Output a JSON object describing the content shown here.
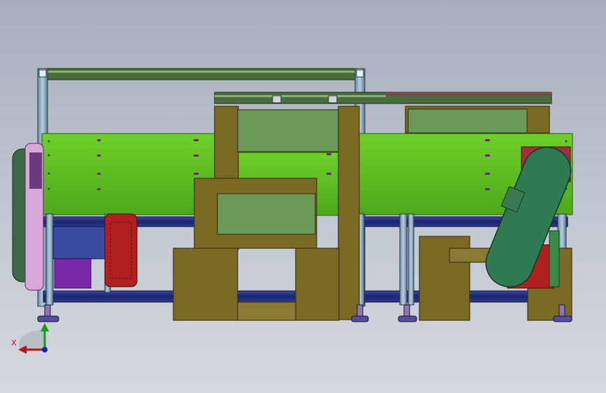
{
  "viewport": {
    "background_top": "#a6aebc",
    "background_bottom": "#d4d8de"
  },
  "colors": {
    "green_panel": "#5dba22",
    "green_panel_dark": "#3f8a12",
    "olive_box": "#7a6a24",
    "olive_edge": "#3e3610",
    "sage_panel": "#6c9a5a",
    "profile_blue": "#1e2a7a",
    "profile_light": "#8ab0c8",
    "frame_gray": "#9aa0a8",
    "belt_green": "#2f7a52",
    "motor_red": "#b02020",
    "motor_purple": "#7a2aa8",
    "foot": "#5a4a9a",
    "hole_magenta": "#c040d0"
  },
  "triad": {
    "x_label": "X",
    "x_color": "#c01010",
    "y_color": "#10a010",
    "z_color": "#1020c0"
  }
}
